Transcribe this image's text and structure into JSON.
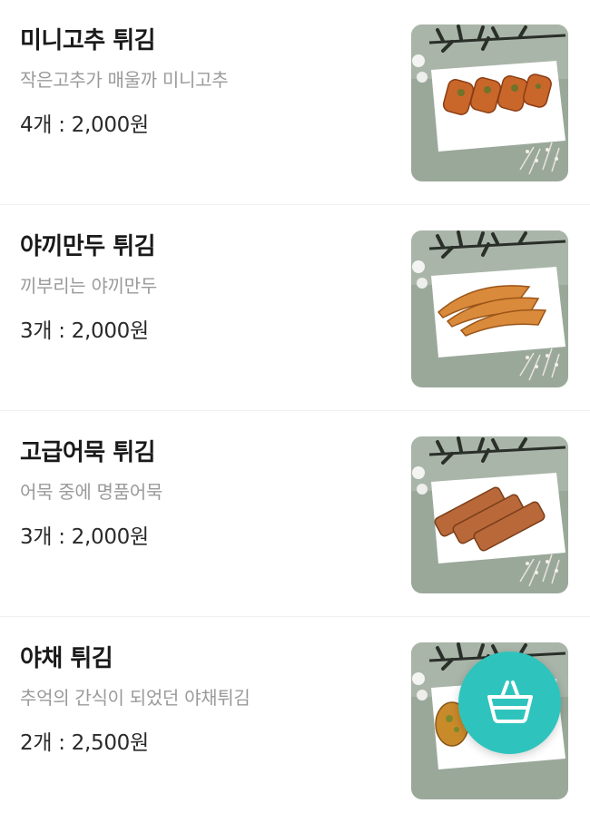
{
  "menu": {
    "items": [
      {
        "name": "미니고추 튀김",
        "description": "작은고추가 매울까 미니고추",
        "price": "4개 : 2,000원",
        "food": "chili-fritter"
      },
      {
        "name": "야끼만두 튀김",
        "description": "끼부리는 야끼만두",
        "price": "3개 : 2,000원",
        "food": "fried-dumpling"
      },
      {
        "name": "고급어묵 튀김",
        "description": "어묵 중에 명품어묵",
        "price": "3개 : 2,000원",
        "food": "fried-fishcake"
      },
      {
        "name": "야채 튀김",
        "description": "추억의 간식이 되었던 야채튀김",
        "price": "2개 : 2,500원",
        "food": "vegetable-fritter"
      }
    ]
  },
  "cart_button": {
    "icon": "shopping-basket-icon",
    "color": "#2ec4bd"
  }
}
